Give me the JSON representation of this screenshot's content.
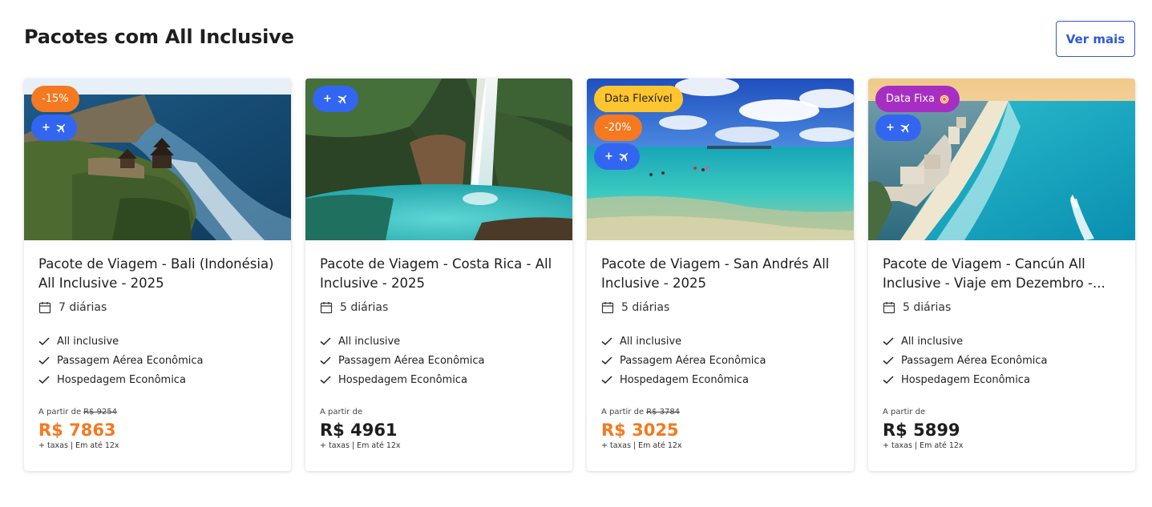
{
  "page": {
    "title": "Pacotes com All Inclusive",
    "see_more": "Ver mais"
  },
  "cards": [
    {
      "badges": {
        "date_type": "",
        "discount": "-15%",
        "flight": "+"
      },
      "title": "Pacote de Viagem - Bali (Indonésia) All Inclusive - 2025",
      "nights": "7 diárias",
      "features": [
        "All inclusive",
        "Passagem Aérea Econômica",
        "Hospedagem Econômica"
      ],
      "from_label": "A partir de",
      "old_price": "R$ 9254",
      "price": "R$ 7863",
      "note": "+ taxas | Em até 12x"
    },
    {
      "badges": {
        "date_type": "",
        "discount": "",
        "flight": "+"
      },
      "title": "Pacote de Viagem - Costa Rica - All Inclusive - 2025",
      "nights": "5 diárias",
      "features": [
        "All inclusive",
        "Passagem Aérea Econômica",
        "Hospedagem Econômica"
      ],
      "from_label": "A partir de",
      "old_price": "",
      "price": "R$ 4961",
      "note": "+ taxas | Em até 12x"
    },
    {
      "badges": {
        "date_type": "Data Flexível",
        "discount": "-20%",
        "flight": "+"
      },
      "title": "Pacote de Viagem - San Andrés All Inclusive - 2025",
      "nights": "5 diárias",
      "features": [
        "All inclusive",
        "Passagem Aérea Econômica",
        "Hospedagem Econômica"
      ],
      "from_label": "A partir de",
      "old_price": "R$ 3784",
      "price": "R$ 3025",
      "note": "+ taxas | Em até 12x"
    },
    {
      "badges": {
        "date_type": "Data Fixa",
        "discount": "",
        "flight": "+"
      },
      "title": "Pacote de Viagem - Cancún All Inclusive - Viaje em Dezembro -...",
      "nights": "5 diárias",
      "features": [
        "All inclusive",
        "Passagem Aérea Econômica",
        "Hospedagem Econômica"
      ],
      "from_label": "A partir de",
      "old_price": "",
      "price": "R$ 5899",
      "note": "+ taxas | Em até 12x"
    }
  ],
  "colors": {
    "accent": "#2f5bd1",
    "discount_badge": "#f47920",
    "flight_badge": "#3366f0",
    "flexible_date_badge": "#ffc52e",
    "fixed_date_badge": "#a72ec3",
    "sale_price": "#f47920",
    "regular_price": "#1e1e1e"
  },
  "icons": {
    "flight_badge": "airplane-icon",
    "nights": "calendar-icon",
    "feature": "check-icon",
    "fixed_date": "target-icon"
  }
}
